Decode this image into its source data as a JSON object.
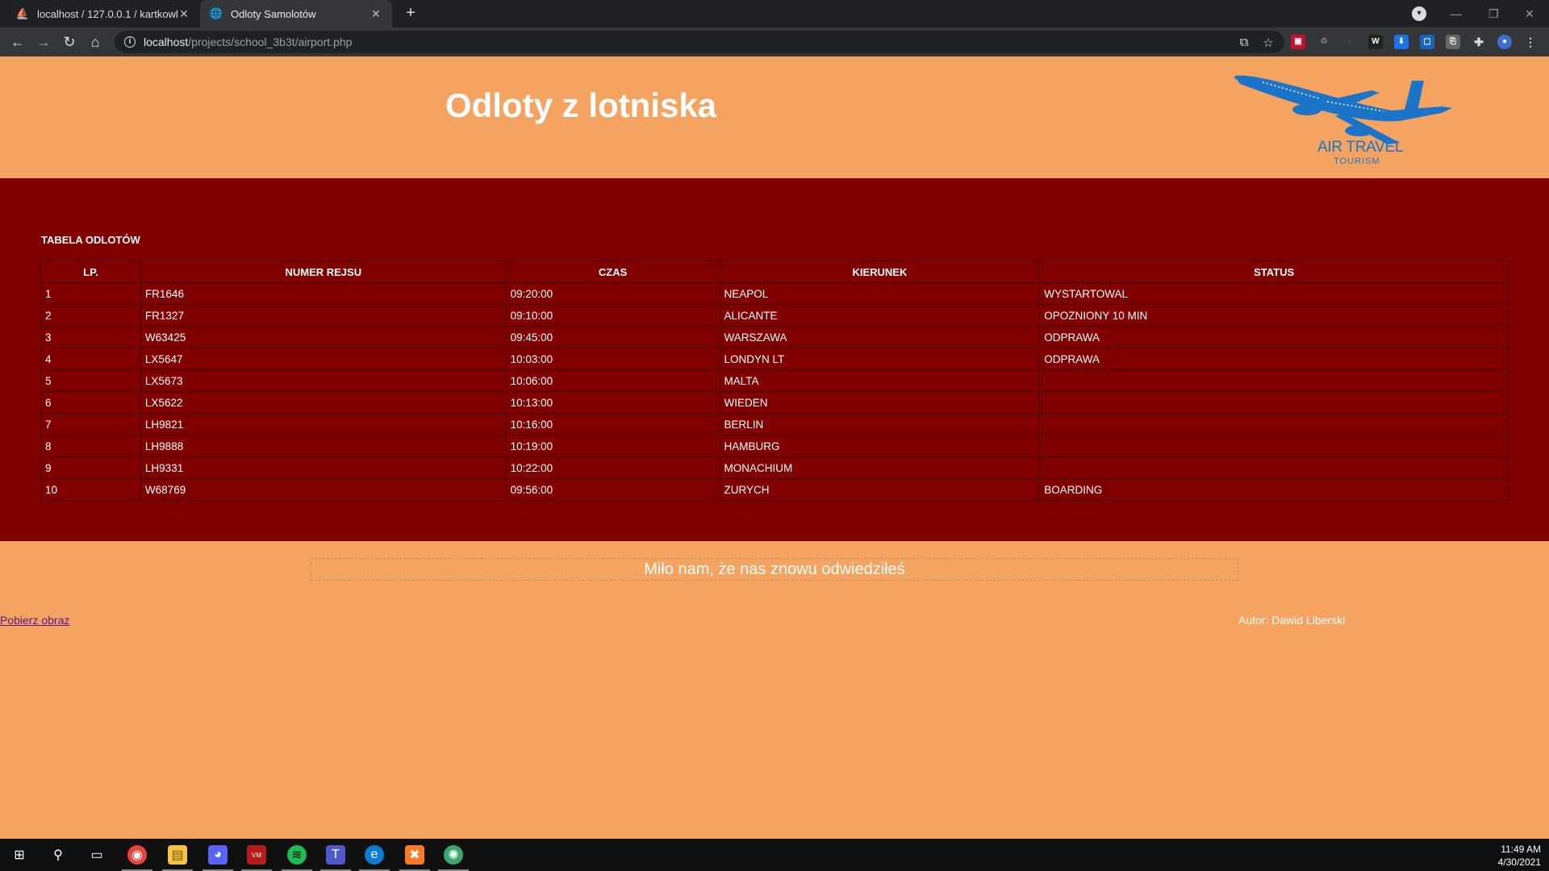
{
  "browser": {
    "tabs": [
      {
        "title": "localhost / 127.0.0.1 / kartkowka",
        "icon": "phpmyadmin-icon",
        "active": false
      },
      {
        "title": "Odloty Samolotów",
        "icon": "globe-icon",
        "active": true
      }
    ],
    "url_host": "localhost",
    "url_path": "/projects/school_3b3t/airport.php"
  },
  "header": {
    "title": "Odloty z lotniska",
    "logo_text": "AIR TRAVEL",
    "logo_subtext": "TOURISM"
  },
  "departures": {
    "caption": "TABELA ODLOTÓW",
    "columns": [
      "LP.",
      "NUMER REJSU",
      "CZAS",
      "KIERUNEK",
      "STATUS"
    ],
    "rows": [
      {
        "lp": "1",
        "flight": "FR1646",
        "time": "09:20:00",
        "destination": "NEAPOL",
        "status": "WYSTARTOWAL"
      },
      {
        "lp": "2",
        "flight": "FR1327",
        "time": "09:10:00",
        "destination": "ALICANTE",
        "status": "OPOZNIONY 10 MIN"
      },
      {
        "lp": "3",
        "flight": "W63425",
        "time": "09:45:00",
        "destination": "WARSZAWA",
        "status": "ODPRAWA"
      },
      {
        "lp": "4",
        "flight": "LX5647",
        "time": "10:03:00",
        "destination": "LONDYN LT",
        "status": "ODPRAWA"
      },
      {
        "lp": "5",
        "flight": "LX5673",
        "time": "10:06:00",
        "destination": "MALTA",
        "status": ""
      },
      {
        "lp": "6",
        "flight": "LX5622",
        "time": "10:13:00",
        "destination": "WIEDEN",
        "status": ""
      },
      {
        "lp": "7",
        "flight": "LH9821",
        "time": "10:16:00",
        "destination": "BERLIN",
        "status": ""
      },
      {
        "lp": "8",
        "flight": "LH9888",
        "time": "10:19:00",
        "destination": "HAMBURG",
        "status": ""
      },
      {
        "lp": "9",
        "flight": "LH9331",
        "time": "10:22:00",
        "destination": "MONACHIUM",
        "status": ""
      },
      {
        "lp": "10",
        "flight": "W68769",
        "time": "09:56:00",
        "destination": "ZURYCH",
        "status": "BOARDING"
      }
    ]
  },
  "footer": {
    "welcome": "Miło nam, że nas znowu odwiedziłeś",
    "download_link": "Pobierz obraz",
    "author": "Autor: Dawid Liberski"
  },
  "taskbar": {
    "time": "11:49 AM",
    "date": "4/30/2021"
  },
  "colors": {
    "page_bg": "#f4a460",
    "main_bg": "#800000",
    "logo_blue": "#1b74c8"
  }
}
